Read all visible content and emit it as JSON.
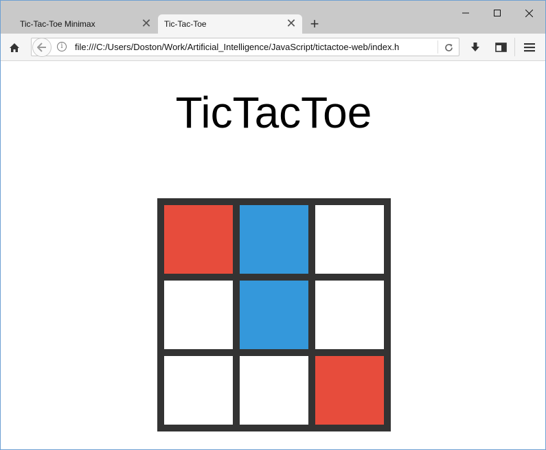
{
  "browser": {
    "tabs": [
      {
        "title": "Tic-Tac-Toe Minimax",
        "active": false
      },
      {
        "title": "Tic-Tac-Toe",
        "active": true
      }
    ],
    "url": "file:///C:/Users/Doston/Work/Artificial_Intelligence/JavaScript/tictactoe-web/index.h"
  },
  "page": {
    "title": "TicTacToe"
  },
  "board": {
    "cells": [
      "red",
      "blue",
      "empty",
      "empty",
      "blue",
      "empty",
      "empty",
      "empty",
      "red"
    ]
  },
  "colors": {
    "red": "#e74c3c",
    "blue": "#3498db",
    "empty": "#ffffff",
    "board_border": "#333333"
  },
  "icons": {
    "home": "home-icon",
    "back": "back-arrow-icon",
    "info": "info-icon",
    "reload": "reload-icon",
    "download": "download-icon",
    "sidebar": "sidebar-icon",
    "menu": "hamburger-menu-icon",
    "close_tab": "close-icon",
    "new_tab": "plus-icon"
  }
}
